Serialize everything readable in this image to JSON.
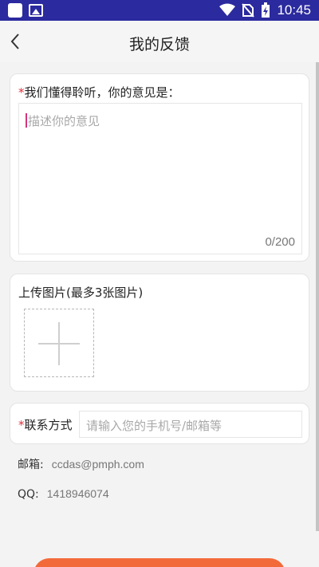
{
  "status_bar": {
    "time": "10:45"
  },
  "header": {
    "title": "我的反馈"
  },
  "feedback": {
    "required_mark": "*",
    "label": "我们懂得聆听，你的意见是：",
    "placeholder": "描述你的意见",
    "count": "0/200"
  },
  "upload": {
    "label": "上传图片(最多3张图片)"
  },
  "contact": {
    "required_mark": "*",
    "label": "联系方式",
    "placeholder": "请输入您的手机号/邮箱等"
  },
  "info": {
    "email_label": "邮箱:",
    "email_value": "ccdas@pmph.com",
    "qq_label": "QQ:",
    "qq_value": "1418946074"
  },
  "colors": {
    "status_bar": "#2b2a9e",
    "accent": "#f36a3a",
    "required": "#e0303a"
  }
}
